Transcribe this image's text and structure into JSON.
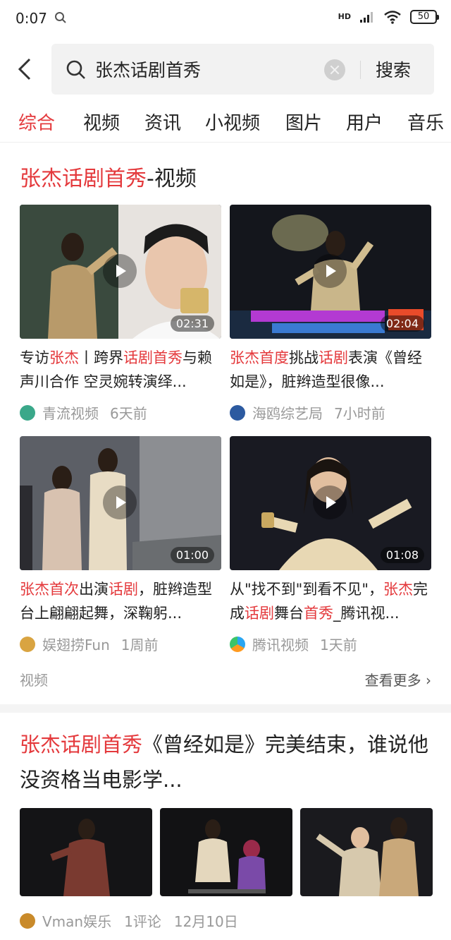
{
  "status_bar": {
    "time": "0:07",
    "network": "HD",
    "battery": "50"
  },
  "search": {
    "query": "张杰话剧首秀",
    "button_label": "搜索"
  },
  "tabs": [
    "综合",
    "视频",
    "资讯",
    "小视频",
    "图片",
    "用户",
    "音乐"
  ],
  "active_tab": "综合",
  "video_section": {
    "title_highlight": "张杰话剧首秀",
    "title_suffix": "-视频",
    "footer_label": "视频",
    "more_label": "查看更多 ›",
    "videos": [
      {
        "title_parts": [
          "专访",
          "张杰",
          "丨跨界",
          "话剧首秀",
          "与赖声川合作 空灵婉转演绎..."
        ],
        "duration": "02:31",
        "source": "青流视频",
        "time": "6天前"
      },
      {
        "title_parts": [
          "",
          "张杰首度",
          "挑战",
          "话剧",
          "表演《曾经如是》，脏辫造型很像..."
        ],
        "duration": "02:04",
        "source": "海鸥综艺局",
        "time": "7小时前"
      },
      {
        "title_parts": [
          "",
          "张杰首次",
          "出演",
          "话剧",
          "，脏辫造型台上翩翩起舞，深鞠躬..."
        ],
        "duration": "01:00",
        "source": "娱翅捞Fun",
        "time": "1周前"
      },
      {
        "title_parts": [
          "从\"找不到\"到看不见\"，",
          "张杰",
          "完成",
          "话剧",
          "舞台",
          "首秀",
          "_腾讯视..."
        ],
        "duration": "01:08",
        "source": "腾讯视频",
        "time": "1天前"
      }
    ]
  },
  "article": {
    "title_highlight": "张杰话剧首秀",
    "title_rest": "《曾经如是》完美结束，谁说他没资格当电影学...",
    "source": "Vman娱乐",
    "comments": "1评论",
    "date": "12月10日"
  },
  "colors": {
    "accent": "#e4393c",
    "muted": "#999999"
  }
}
